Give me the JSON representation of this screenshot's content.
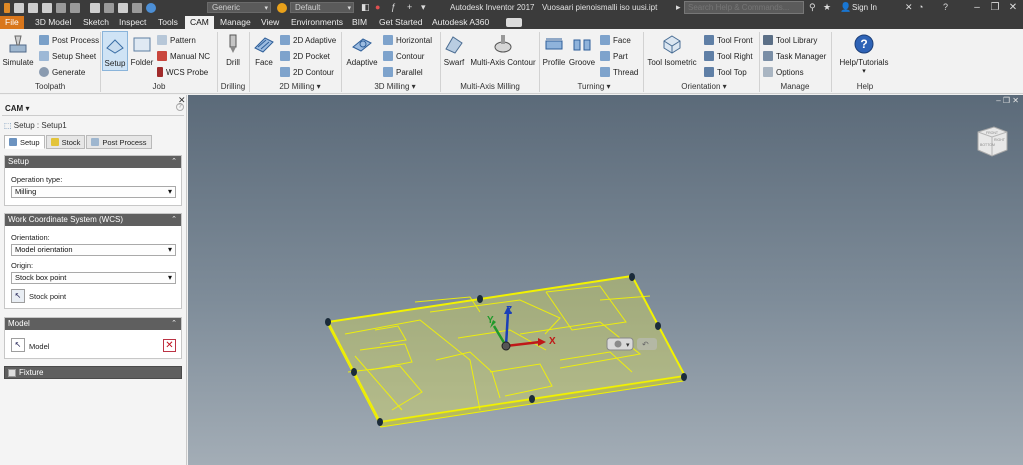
{
  "titlebar": {
    "material_style": "Generic",
    "appearance": "Default",
    "app_title": "Autodesk Inventor 2017",
    "doc_title": "Vuosaari pienoismalli iso uusi.ipt",
    "search_placeholder": "Search Help & Commands...",
    "sign_in": "Sign In"
  },
  "tabs": [
    {
      "label": "File"
    },
    {
      "label": "3D Model"
    },
    {
      "label": "Sketch"
    },
    {
      "label": "Inspect"
    },
    {
      "label": "Tools"
    },
    {
      "label": "CAM"
    },
    {
      "label": "Manage"
    },
    {
      "label": "View"
    },
    {
      "label": "Environments"
    },
    {
      "label": "BIM"
    },
    {
      "label": "Get Started"
    },
    {
      "label": "Autodesk A360"
    }
  ],
  "ribbon": {
    "simulate": "Simulate",
    "post_process": "Post Process",
    "setup_sheet": "Setup Sheet",
    "generate": "Generate",
    "setup": "Setup",
    "folder": "Folder",
    "pattern": "Pattern",
    "manual_nc": "Manual NC",
    "wcs_probe": "WCS Probe",
    "drill": "Drill",
    "face": "Face",
    "adaptive_2d": "2D Adaptive",
    "pocket_2d": "2D Pocket",
    "contour_2d": "2D Contour",
    "adaptive": "Adaptive",
    "horizontal": "Horizontal",
    "contour": "Contour",
    "parallel": "Parallel",
    "swarf": "Swarf",
    "multi_axis_contour": "Multi-Axis Contour",
    "profile": "Profile",
    "groove": "Groove",
    "turn_face": "Face",
    "part": "Part",
    "thread": "Thread",
    "tool_isometric": "Tool Isometric",
    "tool_front": "Tool Front",
    "tool_right": "Tool Right",
    "tool_top": "Tool Top",
    "tool_library": "Tool Library",
    "task_manager": "Task Manager",
    "options": "Options",
    "help_tutorials": "Help/Tutorials",
    "panels": {
      "toolpath": "Toolpath",
      "job": "Job",
      "drilling": "Drilling",
      "milling_2d": "2D Milling",
      "milling_3d": "3D Milling",
      "multi_axis": "Multi-Axis Milling",
      "turning": "Turning",
      "orientation": "Orientation",
      "manage": "Manage",
      "help": "Help"
    }
  },
  "browser": {
    "title": "CAM",
    "breadcrumb": "Setup : Setup1",
    "subtabs": [
      "Setup",
      "Stock",
      "Post Process"
    ],
    "setup_section": {
      "title": "Setup",
      "operation_type_label": "Operation type:",
      "operation_type": "Milling"
    },
    "wcs_section": {
      "title": "Work Coordinate System (WCS)",
      "orientation_label": "Orientation:",
      "orientation": "Model orientation",
      "origin_label": "Origin:",
      "origin": "Stock box point",
      "stock_point": "Stock point"
    },
    "model_section": {
      "title": "Model",
      "model_label": "Model"
    },
    "fixture": "Fixture"
  },
  "viewport": {
    "axis_x": "X",
    "axis_y": "Y",
    "axis_z": "Z",
    "viewcube_faces": [
      "FRONT",
      "RIGHT",
      "BOTTOM"
    ]
  },
  "colors": {
    "file_tab": "#d9761b",
    "stock_highlight": "#f2f200",
    "axis_x": "#c01818",
    "axis_y": "#1f9a2a",
    "axis_z": "#1a3fb8"
  }
}
